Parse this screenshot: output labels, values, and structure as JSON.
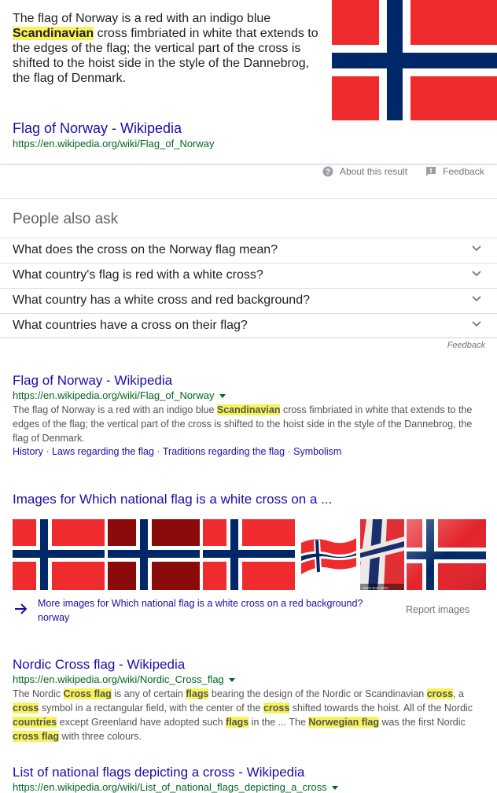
{
  "featured": {
    "text_parts": [
      "The flag of Norway is a red with an indigo blue ",
      "Scandinavian",
      " cross fimbriated in white that extends to the edges of the flag; the vertical part of the cross is shifted to the hoist side in the style of the Dannebrog, the flag of Denmark."
    ],
    "title": "Flag of Norway - Wikipedia",
    "url": "https://en.wikipedia.org/wiki/Flag_of_Norway",
    "about": "About this result",
    "feedback": "Feedback"
  },
  "paa": {
    "title": "People also ask",
    "questions": [
      "What does the cross on the Norway flag mean?",
      "What country's flag is red with a white cross?",
      "What country has a white cross and red background?",
      "What countries have a cross on their flag?"
    ],
    "feedback": "Feedback"
  },
  "result1": {
    "title": "Flag of Norway - Wikipedia",
    "url": "https://en.wikipedia.org/wiki/Flag_of_Norway",
    "desc_parts": [
      "The flag of Norway is a red with an indigo blue ",
      "Scandinavian",
      " cross fimbriated in white that extends to the edges of the flag; the vertical part of the cross is shifted to the hoist side in the style of the Dannebrog, the flag of Denmark."
    ],
    "links": [
      "History",
      "Laws regarding the flag",
      "Traditions regarding the flag",
      "Symbolism"
    ],
    "link_sep": " · "
  },
  "images": {
    "title": "Images for Which national flag is a white cross on a ...",
    "more_line1": "More images for Which national flag is a white cross on a red background?",
    "more_line2": "norway",
    "report": "Report images",
    "watermark": "Alamy stock photo"
  },
  "result2": {
    "title": "Nordic Cross flag - Wikipedia",
    "url": "https://en.wikipedia.org/wiki/Nordic_Cross_flag",
    "desc": [
      {
        "t": "The Nordic ",
        "h": false
      },
      {
        "t": "Cross flag",
        "h": true
      },
      {
        "t": " is any of certain ",
        "h": false
      },
      {
        "t": "flags",
        "h": true
      },
      {
        "t": " bearing the design of the Nordic or Scandinavian ",
        "h": false
      },
      {
        "t": "cross",
        "h": true
      },
      {
        "t": ", a ",
        "h": false
      },
      {
        "t": "cross",
        "h": true
      },
      {
        "t": " symbol in a rectangular field, with the center of the ",
        "h": false
      },
      {
        "t": "cross",
        "h": true
      },
      {
        "t": " shifted towards the hoist. All of the Nordic ",
        "h": false
      },
      {
        "t": "countries",
        "h": true
      },
      {
        "t": " except Greenland have adopted such ",
        "h": false
      },
      {
        "t": "flags",
        "h": true
      },
      {
        "t": " in the ... The ",
        "h": false
      },
      {
        "t": "Norwegian flag",
        "h": true
      },
      {
        "t": " was the first Nordic ",
        "h": false
      },
      {
        "t": "cross flag",
        "h": true
      },
      {
        "t": " with three colours.",
        "h": false
      }
    ]
  },
  "result3": {
    "title": "List of national flags depicting a cross - Wikipedia",
    "url": "https://en.wikipedia.org/wiki/List_of_national_flags_depicting_a_cross"
  },
  "colors": {
    "flag_red": "#EF2B2D",
    "flag_dark_red": "#8B0A0A",
    "flag_blue": "#002868",
    "link": "#1a0dab",
    "url": "#006621",
    "highlight": "#f7f35a"
  }
}
